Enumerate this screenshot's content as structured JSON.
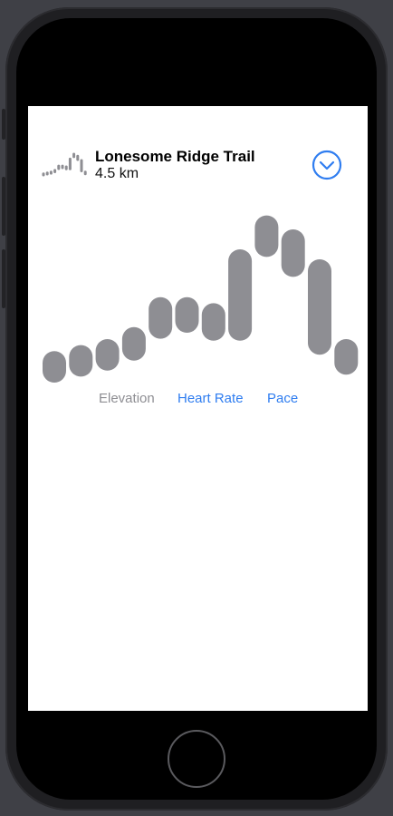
{
  "trail": {
    "name": "Lonesome Ridge Trail",
    "distance": "4.5 km"
  },
  "tabs": [
    {
      "label": "Elevation",
      "active": false
    },
    {
      "label": "Heart Rate",
      "active": true
    },
    {
      "label": "Pace",
      "active": true
    }
  ],
  "colors": {
    "capsule": "#8e8e93",
    "accent": "#2f7df0",
    "background": "#ffffff"
  },
  "icons": {
    "expand": "chevron-down-circle-icon"
  },
  "chart_data": {
    "type": "bar",
    "style": "range capsules",
    "series": [
      {
        "values": [
          {
            "low": 0,
            "high": 4
          },
          {
            "low": 3,
            "high": 7
          },
          {
            "low": 6,
            "high": 10
          },
          {
            "low": 11,
            "high": 16
          },
          {
            "low": 22,
            "high": 31
          },
          {
            "low": 25,
            "high": 31
          },
          {
            "low": 21,
            "high": 28
          },
          {
            "low": 21,
            "high": 55
          },
          {
            "low": 63,
            "high": 72
          },
          {
            "low": 53,
            "high": 65
          },
          {
            "low": 14,
            "high": 50
          },
          {
            "low": 4,
            "high": 10
          }
        ]
      }
    ],
    "ylim": [
      0,
      75
    ]
  }
}
